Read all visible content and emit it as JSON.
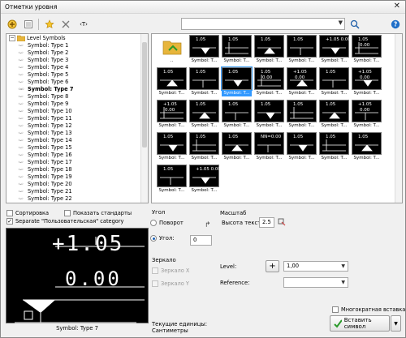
{
  "window": {
    "title": "Отметки уровня",
    "close_glyph": "✕"
  },
  "toolbar": {
    "text_button_label": "‹T›",
    "search_value": "",
    "icons": [
      "add-level-icon",
      "list-icon",
      "favorite-star-icon",
      "delete-icon",
      "text-style-icon",
      "search-icon",
      "help-icon"
    ]
  },
  "tree": {
    "root": "Level Symbols",
    "items": [
      "Symbol: Type 1",
      "Symbol: Type 2",
      "Symbol: Type 3",
      "Symbol: Type 4",
      "Symbol: Type 5",
      "Symbol: Type 6",
      "Symbol: Type 7",
      "Symbol: Type 8",
      "Symbol: Type 9",
      "Symbol: Type 10",
      "Symbol: Type 11",
      "Symbol: Type 12",
      "Symbol: Type 13",
      "Symbol: Type 14",
      "Symbol: Type 15",
      "Symbol: Type 16",
      "Symbol: Type 17",
      "Symbol: Type 18",
      "Symbol: Type 19",
      "Symbol: Type 20",
      "Symbol: Type 21",
      "Symbol: Type 22"
    ],
    "selected_index": 6
  },
  "grid": {
    "folder_caption": "..",
    "tiles": [
      {
        "caption": "Symbol: T...",
        "t1": "1.05",
        "t2": ""
      },
      {
        "caption": "Symbol: T...",
        "t1": "1.05",
        "t2": ""
      },
      {
        "caption": "Symbol: T...",
        "t1": "1.05",
        "t2": ""
      },
      {
        "caption": "Symbol: T...",
        "t1": "1.05",
        "t2": ""
      },
      {
        "caption": "Symbol: T...",
        "t1": "+1.05 0.00",
        "t2": ""
      },
      {
        "caption": "Symbol: T...",
        "t1": "1.05",
        "t2": "0.00"
      },
      {
        "caption": "Symbol: T...",
        "t1": "1.05",
        "t2": ""
      },
      {
        "caption": "Symbol: T...",
        "t1": "1.05",
        "t2": ""
      },
      {
        "caption": "Symbol: T...",
        "t1": "1.05",
        "t2": ""
      },
      {
        "caption": "Symbol: T...",
        "t1": "1.05",
        "t2": "0.00"
      },
      {
        "caption": "Symbol: T...",
        "t1": "+1.05",
        "t2": "0.00"
      },
      {
        "caption": "Symbol: T...",
        "t1": "1.05",
        "t2": ""
      },
      {
        "caption": "Symbol: T...",
        "t1": "+1.05",
        "t2": "0.00"
      },
      {
        "caption": "Symbol: T...",
        "t1": "+1.05",
        "t2": "0.00"
      },
      {
        "caption": "Symbol: T...",
        "t1": "1.05",
        "t2": ""
      },
      {
        "caption": "Symbol: T...",
        "t1": "1.05",
        "t2": ""
      },
      {
        "caption": "Symbol: T...",
        "t1": "1.05",
        "t2": ""
      },
      {
        "caption": "Symbol: T...",
        "t1": "1.05",
        "t2": ""
      },
      {
        "caption": "Symbol: T...",
        "t1": "1.05",
        "t2": ""
      },
      {
        "caption": "Symbol: T...",
        "t1": "+1.05",
        "t2": "0.00"
      },
      {
        "caption": "Symbol: T...",
        "t1": "1.05",
        "t2": ""
      },
      {
        "caption": "Symbol: T...",
        "t1": "1.05",
        "t2": ""
      },
      {
        "caption": "Symbol: T...",
        "t1": "1.05",
        "t2": ""
      },
      {
        "caption": "Symbol: T...",
        "t1": "NN=0.00",
        "t2": ""
      },
      {
        "caption": "Symbol: T...",
        "t1": "1.05",
        "t2": ""
      },
      {
        "caption": "Symbol: T...",
        "t1": "1.05",
        "t2": ""
      },
      {
        "caption": "Symbol: T...",
        "t1": "1.05",
        "t2": ""
      },
      {
        "caption": "Symbol: T...",
        "t1": "1.05",
        "t2": ""
      },
      {
        "caption": "Symbol: T...",
        "t1": "+1.05 0.00",
        "t2": ""
      }
    ],
    "selected_index": 8
  },
  "options": {
    "sort_label": "Сортировка",
    "show_standards_label": "Показать стандарты",
    "separate_label": "Separate \"Пользовательская\" category",
    "separate_checked": "✓"
  },
  "preview": {
    "main_value": "+1.05",
    "sub_value": "0.00",
    "caption": "Symbol: Type 7"
  },
  "angle": {
    "group_label": "Угол",
    "rotation_label": "Поворот",
    "angle_label": "Угол:",
    "angle_value": "0"
  },
  "scale": {
    "group_label": "Масштаб",
    "text_height_label": "Высота текста",
    "text_height_value": "2.5"
  },
  "mirror": {
    "group_label": "Зеркало",
    "mirror_x_label": "Зеркало X",
    "mirror_y_label": "Зеркало Y"
  },
  "level": {
    "level_label": "Level:",
    "level_value": "1,00",
    "reference_label": "Reference:",
    "reference_value": ""
  },
  "units": {
    "label": "Текущие единицы:",
    "value": "Сантиметры"
  },
  "footer": {
    "multi_insert_label": "Многократная вставка",
    "insert_button_label": "Вставить символ"
  },
  "colors": {
    "selection": "#3399ff",
    "accent_green": "#2a9a2a",
    "folder": "#e7b53b"
  }
}
